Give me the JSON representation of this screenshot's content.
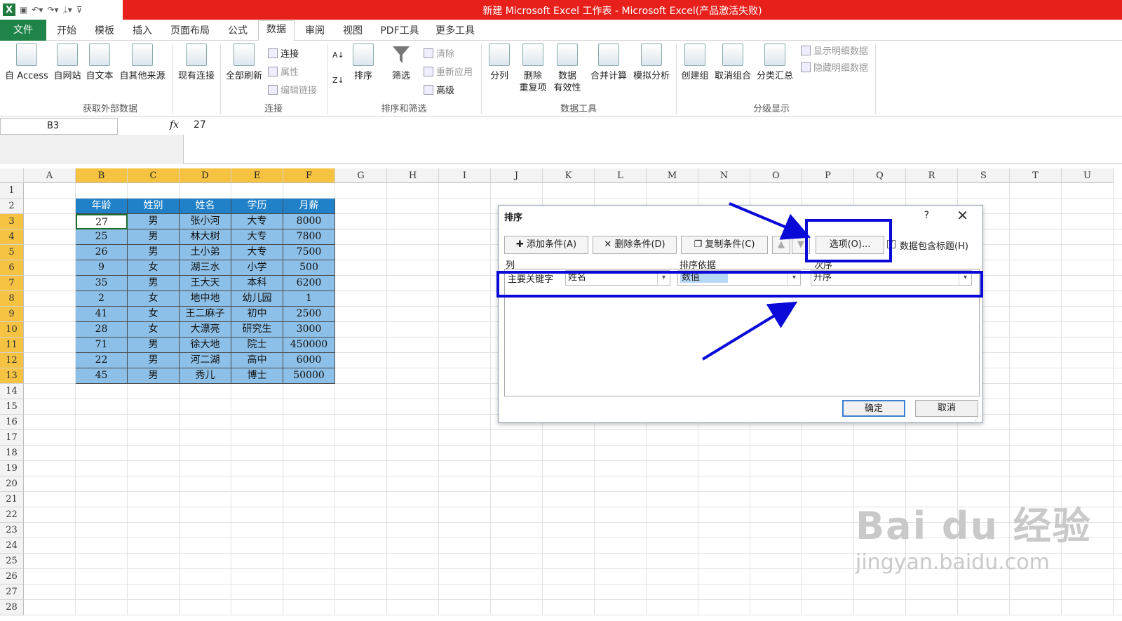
{
  "window": {
    "title": "新建 Microsoft Excel 工作表 - Microsoft Excel(产品激活失败)",
    "app_icon": "X"
  },
  "menu": {
    "file": "文件",
    "tabs": [
      "开始",
      "模板",
      "插入",
      "页面布局",
      "公式",
      "数据",
      "审阅",
      "视图",
      "PDF工具",
      "更多工具"
    ],
    "active": "数据"
  },
  "ribbon": {
    "ext": {
      "buttons": [
        "自 Access",
        "自网站",
        "自文本",
        "自其他来源"
      ],
      "group": "获取外部数据"
    },
    "conn": {
      "existing": "现有连接",
      "refresh": "全部刷新",
      "connect": "连接",
      "props": "属性",
      "edit": "编辑链接",
      "group": "连接"
    },
    "sort": {
      "sort": "排序",
      "filter": "筛选",
      "clear": "清除",
      "reapply": "重新应用",
      "advanced": "高级",
      "group": "排序和筛选"
    },
    "tools": {
      "split": "分列",
      "dedupe1": "删除",
      "dedupe2": "重复项",
      "valid1": "数据",
      "valid2": "有效性",
      "consol": "合并计算",
      "whatif": "模拟分析",
      "group": "数据工具"
    },
    "outline": {
      "group_btn": "创建组",
      "ungroup": "取消组合",
      "subtotal": "分类汇总",
      "show": "显示明细数据",
      "hide": "隐藏明细数据",
      "group": "分级显示"
    }
  },
  "formula": {
    "name": "B3",
    "fx": "fx",
    "value": "27"
  },
  "columns": [
    "A",
    "B",
    "C",
    "D",
    "E",
    "F",
    "G",
    "H",
    "I",
    "J",
    "K",
    "L",
    "M",
    "N",
    "O",
    "P",
    "Q",
    "R",
    "S",
    "T",
    "U"
  ],
  "rows": [
    "1",
    "2",
    "3",
    "4",
    "5",
    "6",
    "7",
    "8",
    "9",
    "10",
    "11",
    "12",
    "13",
    "14",
    "15",
    "16",
    "17",
    "18",
    "19",
    "20",
    "21",
    "22",
    "23",
    "24",
    "25",
    "26",
    "27",
    "28"
  ],
  "table": {
    "headers": [
      "年龄",
      "姓别",
      "姓名",
      "学历",
      "月薪"
    ],
    "rows": [
      [
        "27",
        "男",
        "张小河",
        "大专",
        "8000"
      ],
      [
        "25",
        "男",
        "林大树",
        "大专",
        "7800"
      ],
      [
        "26",
        "男",
        "土小弟",
        "大专",
        "7500"
      ],
      [
        "9",
        "女",
        "湖三水",
        "小学",
        "500"
      ],
      [
        "35",
        "男",
        "王大天",
        "本科",
        "6200"
      ],
      [
        "2",
        "女",
        "地中地",
        "幼儿园",
        "1"
      ],
      [
        "41",
        "女",
        "王二麻子",
        "初中",
        "2500"
      ],
      [
        "28",
        "女",
        "大漂亮",
        "研究生",
        "3000"
      ],
      [
        "71",
        "男",
        "徐大地",
        "院士",
        "450000"
      ],
      [
        "22",
        "男",
        "河二湖",
        "高中",
        "6000"
      ],
      [
        "45",
        "男",
        "秀儿",
        "博士",
        "50000"
      ]
    ]
  },
  "dialog": {
    "title": "排序",
    "help": "?",
    "close": "✕",
    "add": "添加条件(A)",
    "del": "删除条件(D)",
    "copy": "复制条件(C)",
    "options": "选项(O)...",
    "header_check": "数据包含标题(H)",
    "col_hdr": "列",
    "basis_hdr": "排序依据",
    "order_hdr": "次序",
    "key": "主要关键字",
    "key_value": "姓名",
    "basis_value": "数值",
    "order_value": "升序",
    "ok": "确定",
    "cancel": "取消"
  },
  "annotation_color": "#0a0ad8",
  "watermark": {
    "logo": "Bai du 经验",
    "url": "jingyan.baidu.com"
  }
}
